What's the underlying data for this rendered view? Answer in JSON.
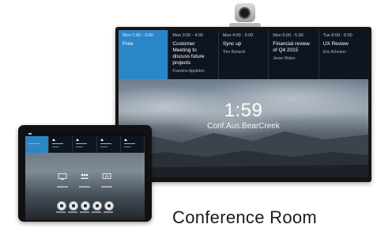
{
  "tv": {
    "calendar": [
      {
        "time": "Mon 1:00 - 3:00",
        "title": "Free",
        "person": "",
        "active": true
      },
      {
        "time": "Mon 3:00 - 4:00",
        "title": "Customer Meeting to discuss future projects",
        "person": "Francine Appleton",
        "active": false
      },
      {
        "time": "Mon 4:00 - 5:00",
        "title": "Sync up",
        "person": "Tom Bonardi",
        "active": false
      },
      {
        "time": "Mon 5:00 - 5:30",
        "title": "Financial review of Q4 2015",
        "person": "Jesse Wales",
        "active": false
      },
      {
        "time": "Tue 8:00 - 9:00",
        "title": "UX Review",
        "person": "Eric Acheson",
        "active": false
      }
    ],
    "clock": "1:59",
    "room": "Conf.Aus.BearCreek"
  },
  "caption": "Conference Room",
  "colors": {
    "accent": "#2b86c8",
    "calendar_bg": "#0e1520"
  },
  "tablet": {
    "actions": [
      "display-icon",
      "people-icon",
      "screen-share-icon"
    ],
    "round_buttons": [
      "stop-icon",
      "dial-icon",
      "call-icon",
      "add-icon",
      "record-icon"
    ]
  }
}
